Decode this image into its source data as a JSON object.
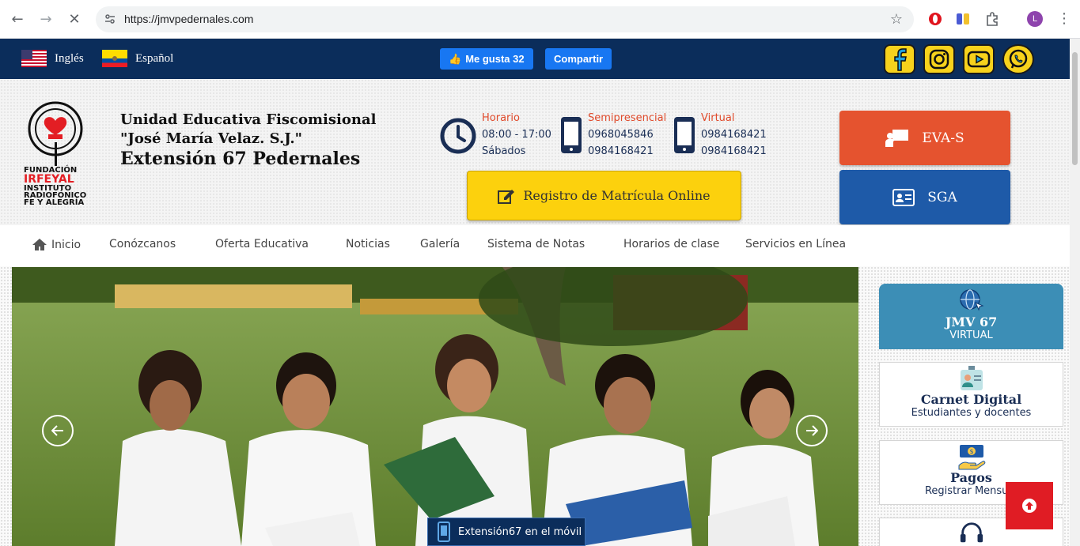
{
  "browser": {
    "url": "https://jmvpedernales.com",
    "profile_initial": "L"
  },
  "topbar": {
    "languages": [
      {
        "label": "Inglés",
        "flag": "usa-flag"
      },
      {
        "label": "Español",
        "flag": "ecuador-flag"
      }
    ],
    "like_label": "Me gusta 32",
    "share_label": "Compartir",
    "social_icons": [
      "facebook-icon",
      "instagram-icon",
      "youtube-icon",
      "whatsapp-icon"
    ],
    "bg_color": "#0b2d5b"
  },
  "header": {
    "logo_text": [
      "FUNDACIÓN",
      "IRFEYAL",
      "INSTITUTO",
      "RADIOFÓNICO",
      "FE Y ALEGRÍA"
    ],
    "school_line1": "Unidad Educativa Fiscomisional",
    "school_line2": "\"José María Velaz. S.J.\"",
    "school_line3": "Extensión 67 Pedernales",
    "horario": {
      "label": "Horario",
      "line1": "08:00 - 17:00",
      "line2": "Sábados"
    },
    "semipresencial": {
      "label": "Semipresencial",
      "line1": "0968045846",
      "line2": "0984168421"
    },
    "virtual": {
      "label": "Virtual",
      "line1": "0984168421",
      "line2": "0984168421"
    },
    "matricula_label": "Registro de Matrícula Online",
    "eva_label": "EVA-S",
    "sga_label": "SGA",
    "eva_color": "#e5532f",
    "sga_color": "#1e5aa8",
    "matricula_color": "#fcd10d"
  },
  "nav": {
    "items": [
      "Inicio",
      "Conózcanos",
      "Oferta Educativa",
      "Noticias",
      "Galería",
      "Sistema de Notas",
      "Horarios de clase",
      "Servicios en Línea"
    ]
  },
  "slider": {
    "mobile_label": "Extensión67 en el móvil"
  },
  "sidebar": {
    "cards": [
      {
        "title": "JMV 67",
        "subtitle": "VIRTUAL",
        "icon": "globe-cursor-icon"
      },
      {
        "title": "Carnet Digital",
        "subtitle": "Estudiantes y docentes",
        "icon": "id-badge-icon"
      },
      {
        "title": "Pagos",
        "subtitle": "Registrar Mensual",
        "icon": "payment-icon"
      },
      {
        "title": "",
        "subtitle": "",
        "icon": "headset-icon"
      }
    ],
    "virtual_color": "#3c8eb6"
  }
}
